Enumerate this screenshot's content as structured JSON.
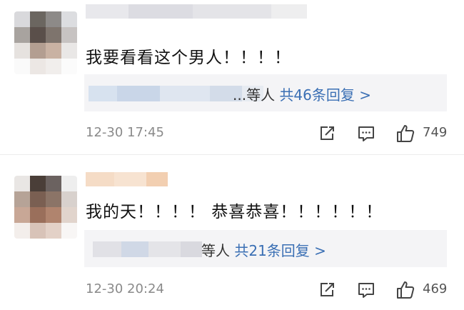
{
  "comments": [
    {
      "text": "我要看看这个男人！！！！",
      "reply_tail": "...等人",
      "reply_link": "共46条回复 >",
      "time": "12-30 17:45",
      "likes": "749"
    },
    {
      "text": "我的天！！！！ 恭喜恭喜！！！！！！",
      "reply_tail": "等人",
      "reply_link": "共21条回复 >",
      "time": "12-30 20:24",
      "likes": "469"
    }
  ],
  "icons": {
    "share": "share-icon",
    "comment": "comment-icon",
    "like": "thumbs-up-icon"
  },
  "colors": {
    "reply_link": "#3a6fb4",
    "reply_background": "#f4f4f6",
    "meta_text": "#8a8a8a"
  }
}
